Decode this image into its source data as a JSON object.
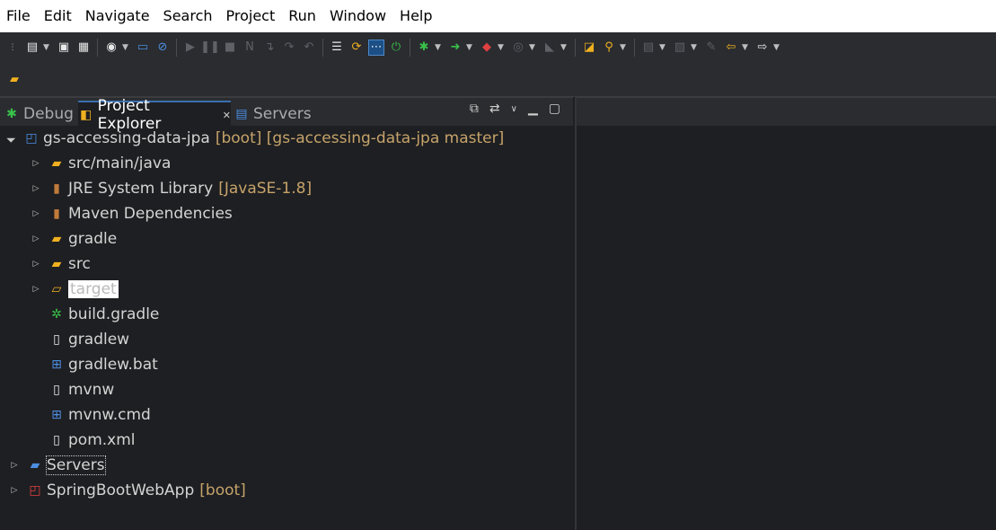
{
  "menu": [
    "File",
    "Edit",
    "Navigate",
    "Search",
    "Project",
    "Run",
    "Window",
    "Help"
  ],
  "tabs": {
    "debug": "Debug",
    "explorer": "Project Explorer",
    "servers": "Servers"
  },
  "tree": {
    "project": {
      "label": "gs-accessing-data-jpa",
      "decoration": "[boot] [gs-accessing-data-jpa master]"
    },
    "items": [
      {
        "label": "src/main/java",
        "decoration": ""
      },
      {
        "label": "JRE System Library",
        "decoration": "[JavaSE-1.8]"
      },
      {
        "label": "Maven Dependencies",
        "decoration": ""
      },
      {
        "label": "gradle",
        "decoration": ""
      },
      {
        "label": "src",
        "decoration": ""
      },
      {
        "label": "target",
        "decoration": ""
      },
      {
        "label": "build.gradle",
        "decoration": ""
      },
      {
        "label": "gradlew",
        "decoration": ""
      },
      {
        "label": "gradlew.bat",
        "decoration": ""
      },
      {
        "label": "mvnw",
        "decoration": ""
      },
      {
        "label": "mvnw.cmd",
        "decoration": ""
      },
      {
        "label": "pom.xml",
        "decoration": ""
      }
    ],
    "servers": {
      "label": "Servers"
    },
    "webapp": {
      "label": "SpringBootWebApp",
      "decoration": "[boot]"
    }
  },
  "colors": {
    "background": "#1e1f22",
    "toolbar": "#2a2c30",
    "decoration": "#c6a36a",
    "text": "#d4d4d4"
  }
}
